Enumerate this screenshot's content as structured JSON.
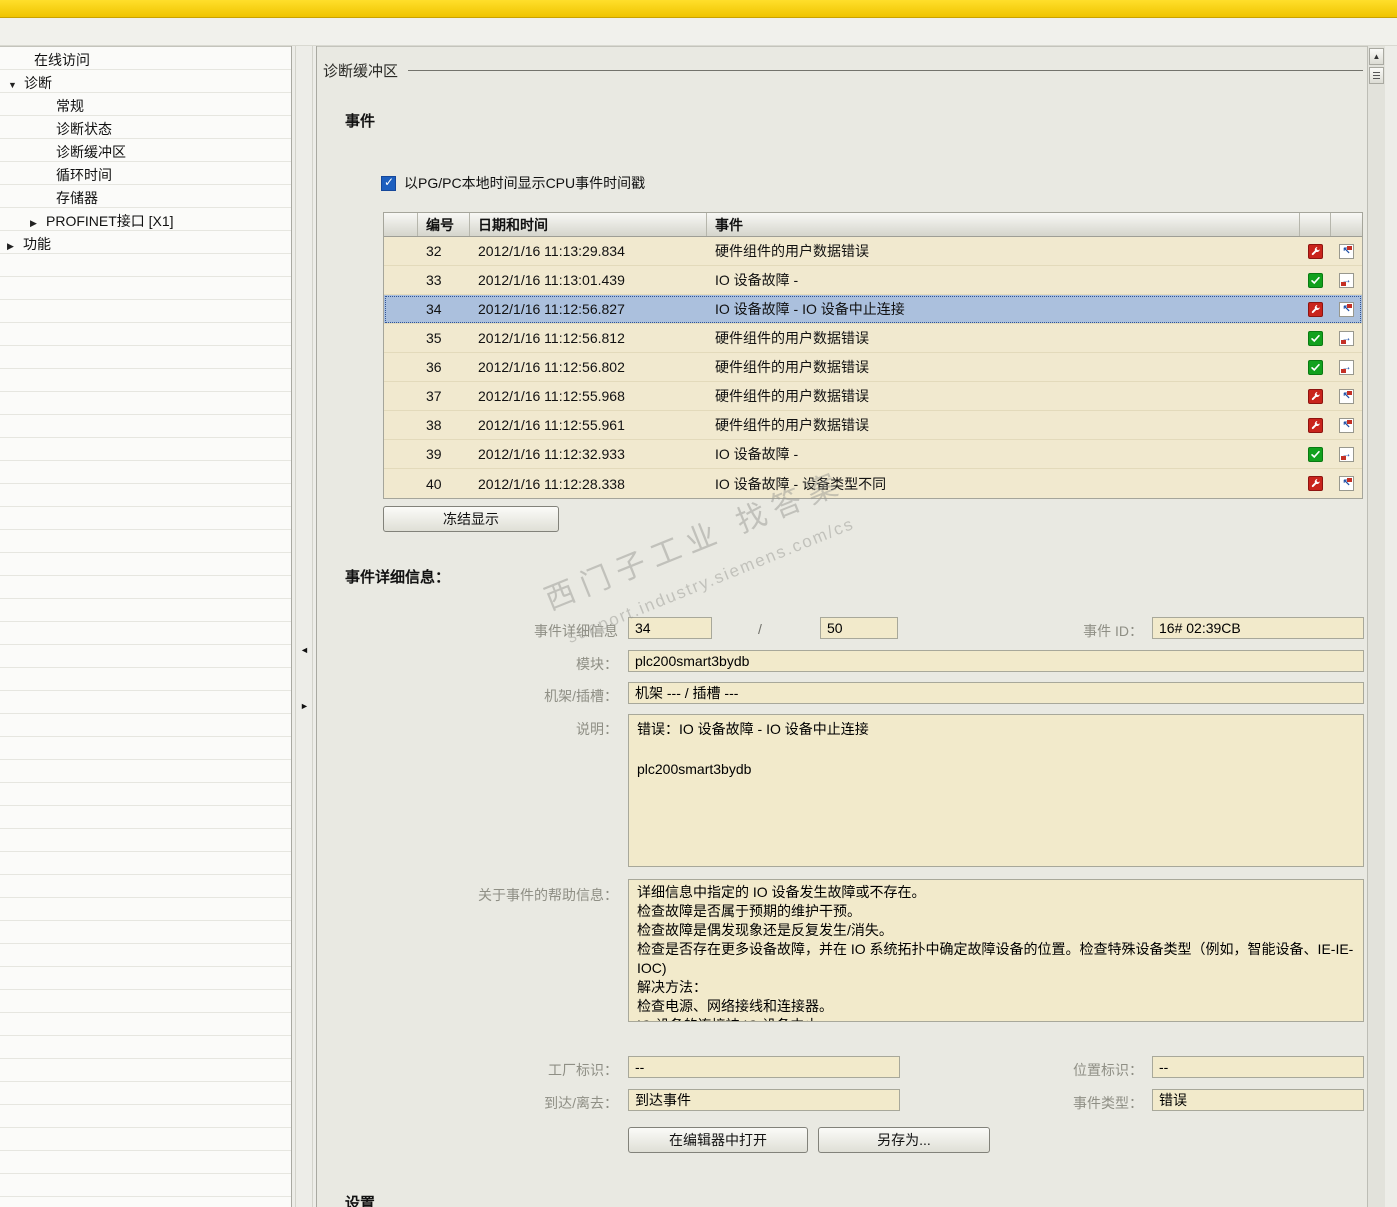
{
  "icons": {
    "expander_open": "▼",
    "expander_collapsed": "▶",
    "scroll_up": "▲",
    "collapse_left": "◄",
    "collapse_right": "►"
  },
  "sidebar": {
    "items": [
      {
        "label": "在线访问"
      },
      {
        "label": "诊断"
      },
      {
        "label": "常规"
      },
      {
        "label": "诊断状态"
      },
      {
        "label": "诊断缓冲区"
      },
      {
        "label": "循环时间"
      },
      {
        "label": "存储器"
      },
      {
        "label": "PROFINET接口 [X1]"
      },
      {
        "label": "功能"
      }
    ]
  },
  "main": {
    "page_title": "诊断缓冲区",
    "events": {
      "heading": "事件",
      "timestamp_checkbox": {
        "checked": true,
        "label": "以PG/PC本地时间显示CPU事件时间戳"
      },
      "table": {
        "columns": {
          "no": "编号",
          "datetime": "日期和时间",
          "event": "事件"
        },
        "rows": [
          {
            "no": "32",
            "datetime": "2012/1/16 11:13:29.834",
            "event": "硬件组件的用户数据错误",
            "status": "fault",
            "direction": "arriving",
            "selected": false
          },
          {
            "no": "33",
            "datetime": "2012/1/16 11:13:01.439",
            "event": "IO 设备故障 -",
            "status": "ok",
            "direction": "departing",
            "selected": false
          },
          {
            "no": "34",
            "datetime": "2012/1/16 11:12:56.827",
            "event": "IO 设备故障 - IO 设备中止连接",
            "status": "fault",
            "direction": "arriving",
            "selected": true
          },
          {
            "no": "35",
            "datetime": "2012/1/16 11:12:56.812",
            "event": "硬件组件的用户数据错误",
            "status": "ok",
            "direction": "departing",
            "selected": false
          },
          {
            "no": "36",
            "datetime": "2012/1/16 11:12:56.802",
            "event": "硬件组件的用户数据错误",
            "status": "ok",
            "direction": "departing",
            "selected": false
          },
          {
            "no": "37",
            "datetime": "2012/1/16 11:12:55.968",
            "event": "硬件组件的用户数据错误",
            "status": "fault",
            "direction": "arriving",
            "selected": false
          },
          {
            "no": "38",
            "datetime": "2012/1/16 11:12:55.961",
            "event": "硬件组件的用户数据错误",
            "status": "fault",
            "direction": "arriving",
            "selected": false
          },
          {
            "no": "39",
            "datetime": "2012/1/16 11:12:32.933",
            "event": "IO 设备故障 -",
            "status": "ok",
            "direction": "departing",
            "selected": false
          },
          {
            "no": "40",
            "datetime": "2012/1/16 11:12:28.338",
            "event": "IO 设备故障 - 设备类型不同",
            "status": "fault",
            "direction": "arriving",
            "selected": false
          }
        ]
      },
      "freeze_button": "冻结显示"
    },
    "details": {
      "heading": "事件详细信息：",
      "index_label": "事件详细信息",
      "index_value": "34",
      "index_separator": "/",
      "index_total": "50",
      "event_id_label": "事件 ID：",
      "event_id_value": "16# 02:39CB",
      "module_label": "模块：",
      "module_value": "plc200smart3bydb",
      "rack_slot_label": "机架/插槽：",
      "rack_slot_value": "机架 --- / 插槽 ---",
      "description_label": "说明：",
      "description_value": "错误：IO 设备故障 - IO 设备中止连接\n\nplc200smart3bydb",
      "help_label": "关于事件的帮助信息：",
      "help_value": "详细信息中指定的 IO 设备发生故障或不存在。\n检查故障是否属于预期的维护干预。\n检查故障是偶发现象还是反复发生/消失。\n检查是否存在更多设备故障，并在 IO 系统拓扑中确定故障设备的位置。检查特殊设备类型（例如，智能设备、IE-IE-IOC)\n解决方法：\n检查电源、网络接线和连接器。\nIO 设备的连接被 IO 设备中止。",
      "plant_label": "工厂标识：",
      "plant_value": "--",
      "location_label": "位置标识：",
      "location_value": "--",
      "arrival_label": "到达/离去：",
      "arrival_value": "到达事件",
      "type_label": "事件类型：",
      "type_value": "错误",
      "open_editor_button": "在编辑器中打开",
      "save_as_button": "另存为..."
    },
    "settings_heading": "设置"
  },
  "watermark": {
    "line1": "西门子工业 找答案",
    "line2": "support.industry.siemens.com/cs"
  },
  "colors": {
    "accent_yellow": "#F0C400",
    "row_beige": "#F1E9CF",
    "selected_blue": "#ABC0DD",
    "fault_red": "#C9241C",
    "ok_green": "#12A11E"
  }
}
